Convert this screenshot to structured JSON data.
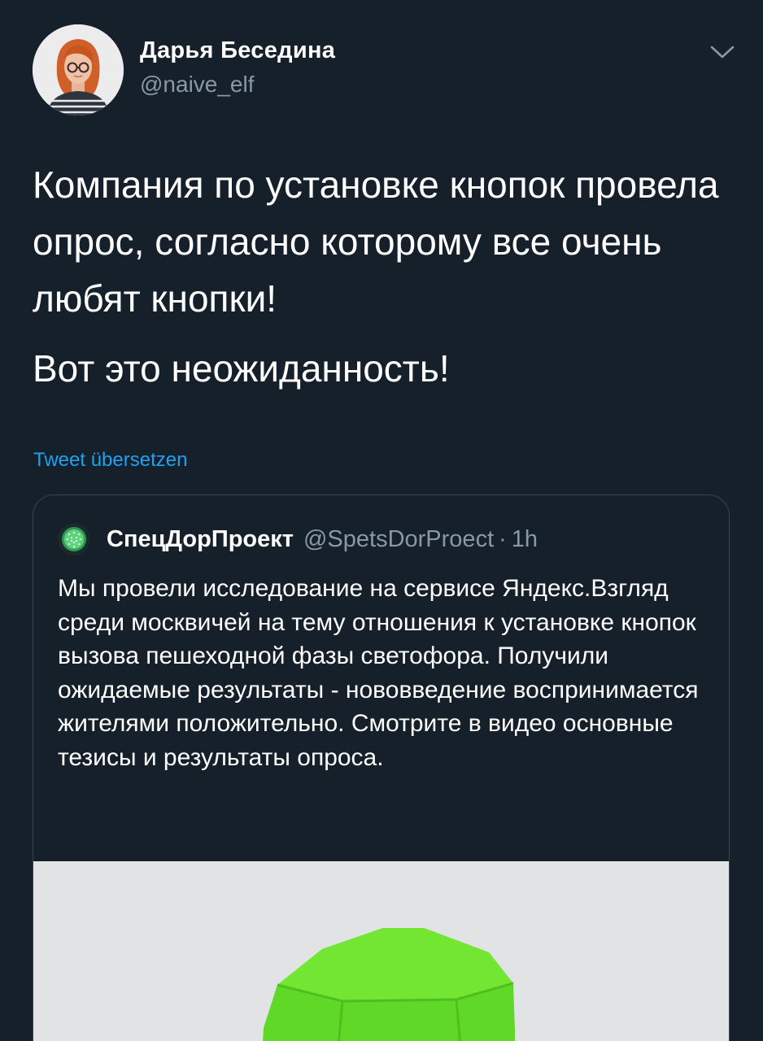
{
  "tweet": {
    "author": {
      "name": "Дарья Беседина",
      "handle": "@naive_elf",
      "avatar_icon": "profile-photo"
    },
    "menu_icon": "chevron-down-icon",
    "text_paragraphs": [
      "Компания по установке кнопок провела опрос, согласно которому все очень любят кнопки!",
      "Вот это неожиданность!"
    ],
    "translate_link": "Tweet übersetzen",
    "quoted": {
      "author_name": "СпецДорПроект",
      "author_handle": "@SpetsDorProect",
      "separator": "·",
      "time": "1h",
      "text": "Мы провели исследование на сервисе Яндекс.Взгляд среди москвичей на тему отношения к установке кнопок вызова пешеходной фазы светофора. Получили ожидаемые результаты - нововведение воспринимается жителями положительно. Смотрите в видео основные тезисы и результаты опроса.",
      "media_icon": "green-button-video-preview"
    }
  },
  "colors": {
    "background": "#15202b",
    "text": "#ffffff",
    "secondary_text": "#8899a6",
    "link": "#1da1f2",
    "border": "#38444d",
    "media_background": "#e2e3e5",
    "button_green": "#69e02a"
  }
}
